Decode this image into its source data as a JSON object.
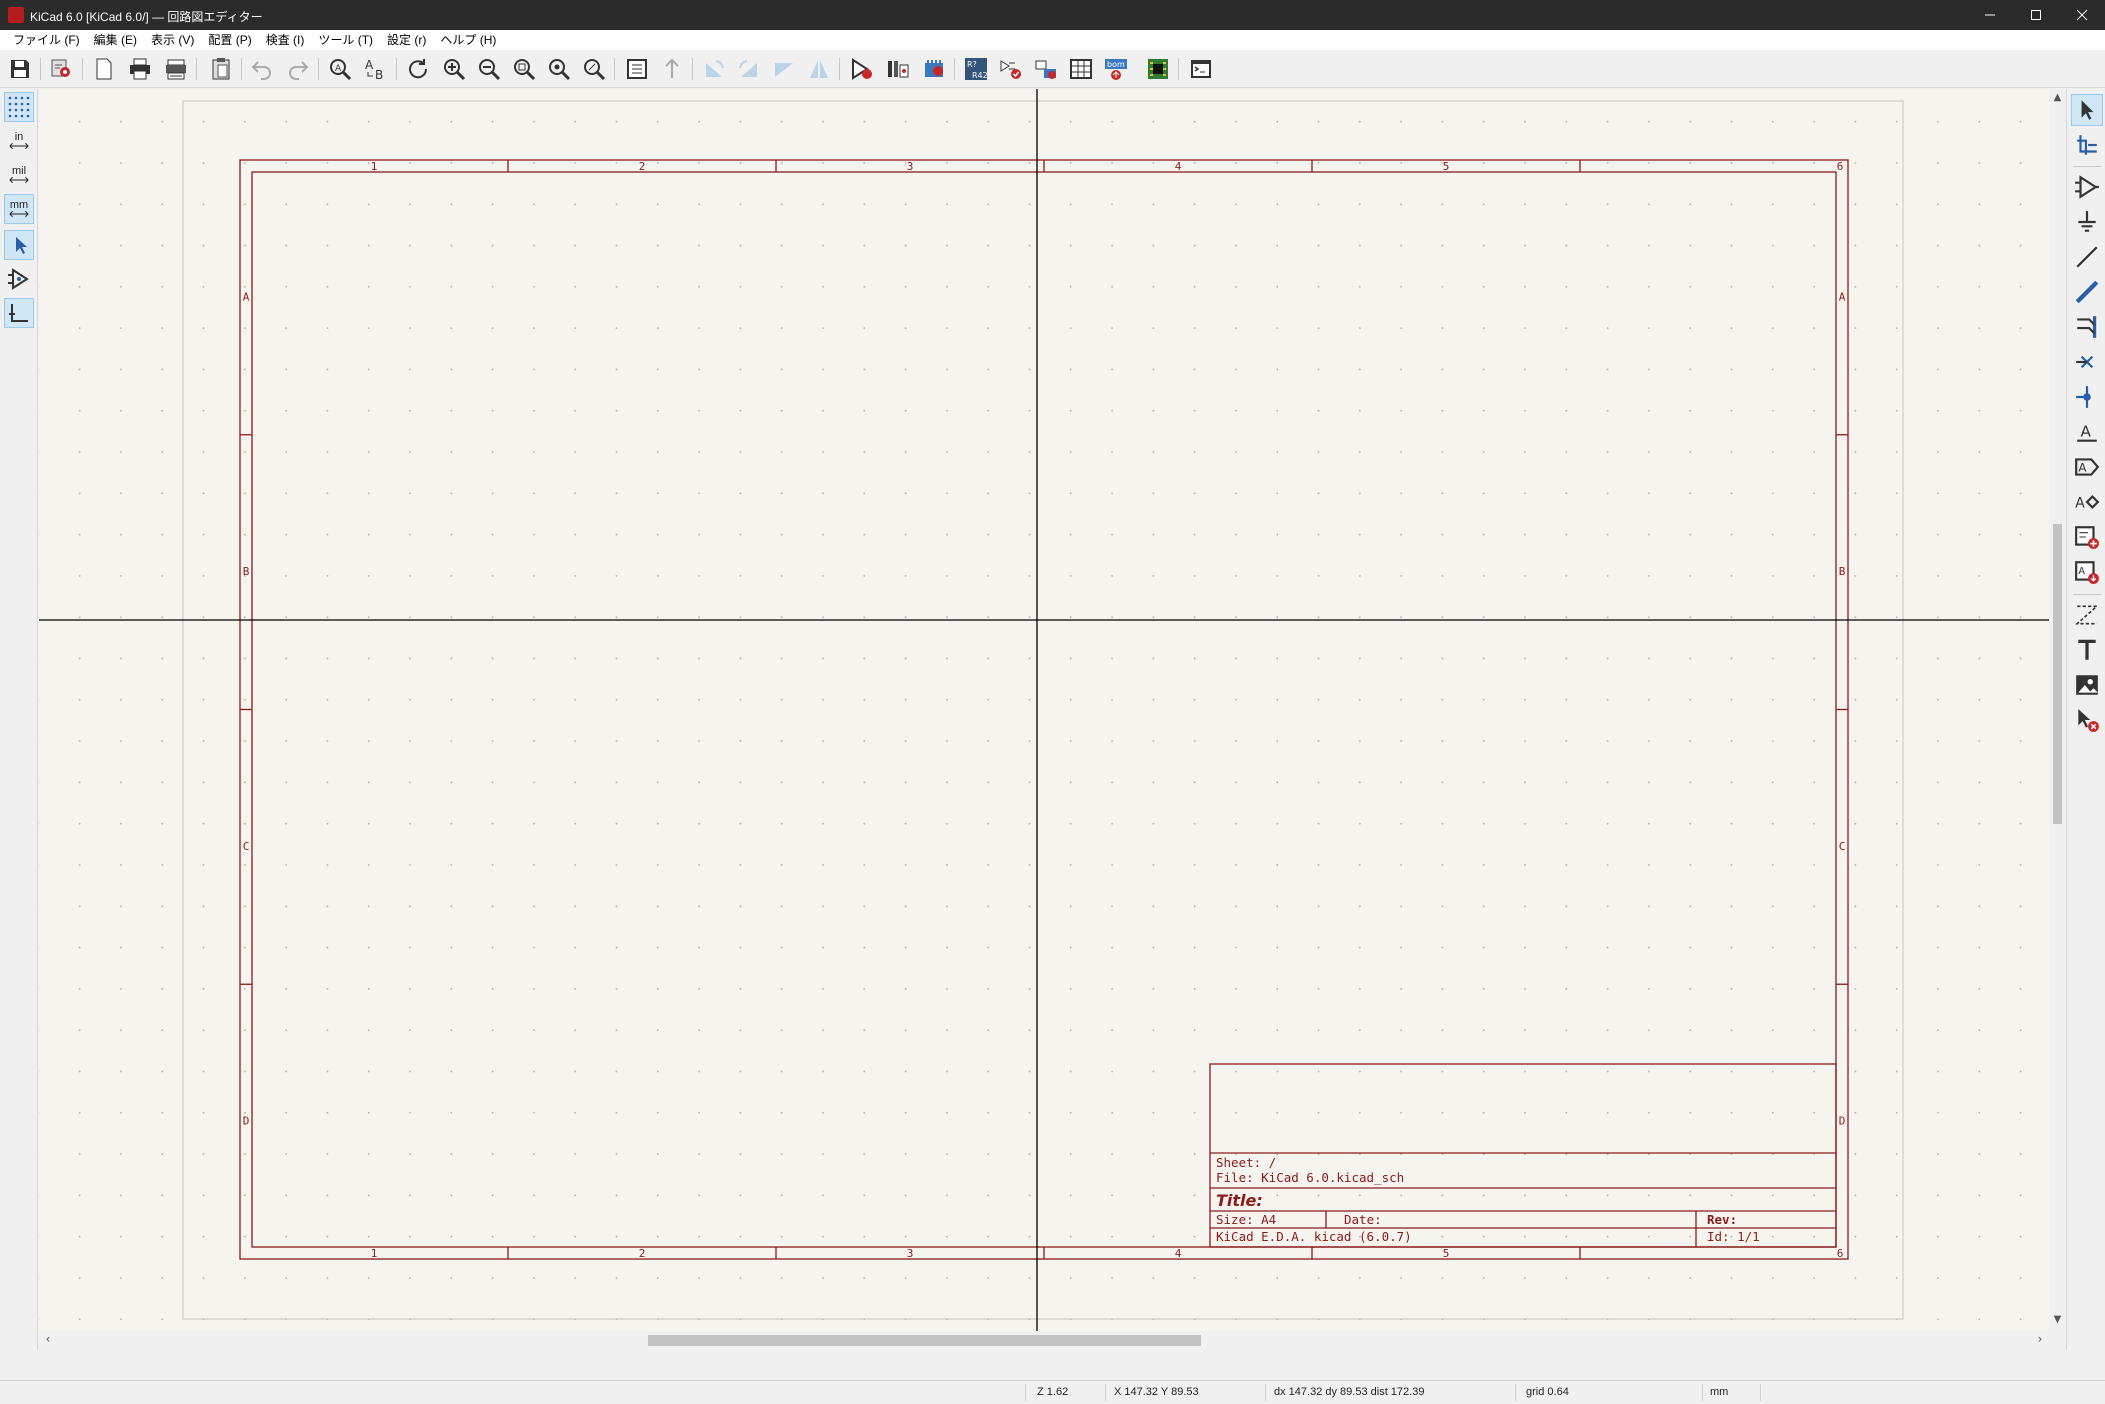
{
  "window": {
    "title": "KiCad 6.0 [KiCad 6.0/] — 回路図エディター"
  },
  "menu": [
    "ファイル (F)",
    "編集 (E)",
    "表示 (V)",
    "配置 (P)",
    "検査 (I)",
    "ツール (T)",
    "設定 (r)",
    "ヘルプ (H)"
  ],
  "left_toolbar": {
    "units_in": "in",
    "units_mil": "mil",
    "units_mm": "mm"
  },
  "sheet": {
    "col_labels": [
      "1",
      "2",
      "3",
      "4",
      "5",
      "6"
    ],
    "row_labels": [
      "A",
      "B",
      "C",
      "D"
    ],
    "title_block": {
      "sheet": "Sheet: /",
      "file": "File: KiCad 6.0.kicad_sch",
      "title": "Title:",
      "size": "Size: A4",
      "date": "Date:",
      "rev": "Rev:",
      "generator": "KiCad E.D.A.  kicad (6.0.7)",
      "id": "Id: 1/1"
    }
  },
  "status": {
    "zoom": "Z 1.62",
    "xy": "X 147.32  Y 89.53",
    "delta": "dx 147.32  dy 89.53  dist 172.39",
    "grid": "grid 0.64",
    "units": "mm"
  },
  "colors": {
    "border": "#8b1a1a",
    "canvas": "#f5f4ef",
    "crosshair": "#000000"
  }
}
